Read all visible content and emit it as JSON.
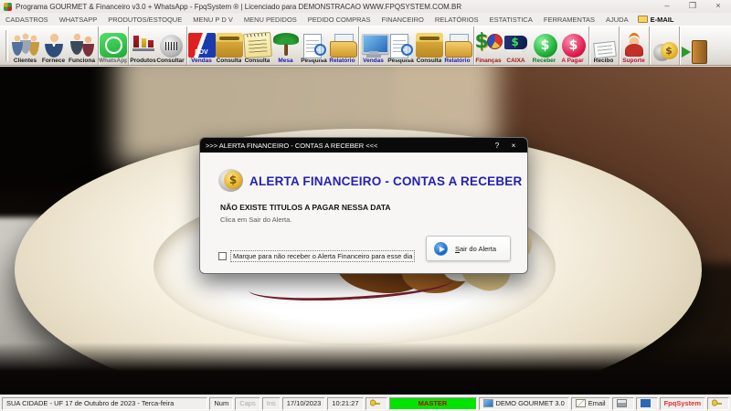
{
  "window": {
    "title": "Programa GOURMET & Financeiro v3.0 + WhatsApp - FpqSystem ® | Licenciado para  DEMONSTRACAO WWW.FPQSYSTEM.COM.BR",
    "minimize_glyph": "–",
    "maximize_glyph": "❒",
    "close_glyph": "×"
  },
  "menu": {
    "items": [
      {
        "name": "menu-cadastros",
        "label": "CADASTROS"
      },
      {
        "name": "menu-whatsapp",
        "label": "WHATSAPP"
      },
      {
        "name": "menu-produtos-estoque",
        "label": "PRODUTOS/ESTOQUE"
      },
      {
        "name": "menu-pdv",
        "label": "MENU P D V"
      },
      {
        "name": "menu-pedidos",
        "label": "MENU PEDIDOS"
      },
      {
        "name": "menu-pedido-compras",
        "label": "PEDIDO COMPRAS"
      },
      {
        "name": "menu-financeiro",
        "label": "FINANCEIRO"
      },
      {
        "name": "menu-relatorios",
        "label": "RELATÓRIOS"
      },
      {
        "name": "menu-estatistica",
        "label": "ESTATISTICA"
      },
      {
        "name": "menu-ferramentas",
        "label": "FERRAMENTAS"
      },
      {
        "name": "menu-ajuda",
        "label": "AJUDA"
      }
    ],
    "email_label": "E-MAIL"
  },
  "toolbar": {
    "items": [
      {
        "name": "toolbar-clientes",
        "icon": "clients-people-icon",
        "iclass": "i-clients",
        "label": "Clientes"
      },
      {
        "name": "toolbar-fornecedor",
        "icon": "supplier-person-icon",
        "iclass": "i-supplier",
        "label": "Fornece"
      },
      {
        "name": "toolbar-funcionario",
        "icon": "employees-people-icon",
        "iclass": "i-employees",
        "label": "Funciona"
      },
      {
        "name": "toolbar-whatsapp",
        "icon": "whatsapp-icon",
        "iclass": "i-whatsapp",
        "label": "WhatsApp",
        "color": "#666666",
        "classes": "grp"
      },
      {
        "name": "toolbar-produtos",
        "icon": "bottles-icon",
        "iclass": "i-products",
        "label": "Produtos",
        "classes": "grp"
      },
      {
        "name": "toolbar-consultar-produtos",
        "icon": "barcode-coin-icon",
        "iclass": "i-barcode",
        "label": "Consultar"
      },
      {
        "name": "toolbar-vendas-pdv",
        "icon": "pdv-flag-icon",
        "iclass": "i-pdv",
        "label": "Vendas",
        "color": "#1a1ab0",
        "classes": "grp"
      },
      {
        "name": "toolbar-consulta-pdv",
        "icon": "drawer-icon",
        "iclass": "i-drawer",
        "label": "Consulta"
      },
      {
        "name": "toolbar-consulta-cupom",
        "icon": "notepad-icon",
        "iclass": "i-notepad",
        "label": "Consulta"
      },
      {
        "name": "toolbar-mesa",
        "icon": "palm-tree-icon",
        "iclass": "i-palm",
        "label": "Mesa",
        "color": "#1a1ab0"
      },
      {
        "name": "toolbar-pesquisa-mesa",
        "icon": "search-docs-icon",
        "iclass": "i-searchdocs",
        "label": "Pesquisa"
      },
      {
        "name": "toolbar-relatorio-mesa",
        "icon": "report-folder-icon",
        "iclass": "i-folder",
        "label": "Relatório",
        "color": "#1a1ab0"
      },
      {
        "name": "toolbar-vendas",
        "icon": "monitor-sales-icon",
        "iclass": "i-monitor",
        "label": "Vendas",
        "color": "#1a1ab0",
        "classes": "grp"
      },
      {
        "name": "toolbar-pesquisa-vendas",
        "icon": "search-docs-icon",
        "iclass": "i-searchdocs",
        "label": "Pesquisa"
      },
      {
        "name": "toolbar-consulta-vendas",
        "icon": "drawer-icon",
        "iclass": "i-drawer",
        "label": "Consulta"
      },
      {
        "name": "toolbar-relatorio-vendas",
        "icon": "report-folder-icon",
        "iclass": "i-folder",
        "label": "Relatório",
        "color": "#1a1ab0"
      },
      {
        "name": "toolbar-financas",
        "icon": "money-pie-icon",
        "iclass": "i-financas",
        "label": "Finanças",
        "color": "#a01818",
        "classes": "grp"
      },
      {
        "name": "toolbar-caixa",
        "icon": "cashbook-icon",
        "iclass": "i-caixa",
        "label": "CAIXA",
        "color": "#a01818"
      },
      {
        "name": "toolbar-receber",
        "icon": "green-dollar-coin-icon",
        "iclass": "i-coin-green",
        "label": "Receber",
        "color": "#0d7a1f"
      },
      {
        "name": "toolbar-a-pagar",
        "icon": "pink-dollar-coin-icon",
        "iclass": "i-coin-pink",
        "label": "A Pagar",
        "color": "#c01030"
      },
      {
        "name": "toolbar-recibo",
        "icon": "receipt-icon",
        "iclass": "i-recibo",
        "label": "Recibo",
        "classes": "grp"
      },
      {
        "name": "toolbar-suporte",
        "icon": "support-headset-icon",
        "iclass": "i-suporte",
        "label": "Suporte",
        "color": "#c01030",
        "classes": "grp"
      },
      {
        "name": "toolbar-moedas",
        "icon": "gold-coin-icon",
        "iclass": "i-coin-gold",
        "label": "",
        "classes": "grp"
      },
      {
        "name": "toolbar-sair",
        "icon": "exit-door-icon",
        "iclass": "i-exit",
        "label": "",
        "classes": "grp"
      }
    ]
  },
  "dialog": {
    "title": ">>> ALERTA FINANCEIRO - CONTAS A RECEBER <<<",
    "help_glyph": "?",
    "close_glyph": "×",
    "heading": "ALERTA FINANCEIRO - CONTAS A RECEBER",
    "message": "NÃO EXISTE TITULOS A PAGAR NESSA DATA",
    "sub_message": "Clica em Sair do Alerta.",
    "checkbox_label": "Marque para não receber o Alerta Financeiro para esse dia",
    "checkbox_checked": false,
    "button_label": "Sair do Alerta"
  },
  "statusbar": {
    "panels": [
      {
        "name": "status-location-date",
        "text": "SUA CIDADE - UF 17 de Outubro de 2023 - Terca-feira",
        "classes": "grow"
      },
      {
        "name": "status-num-lock",
        "text": "Num"
      },
      {
        "name": "status-caps-lock",
        "text": "Caps",
        "classes": "dim"
      },
      {
        "name": "status-insert",
        "text": "Ins",
        "classes": "dim"
      },
      {
        "name": "status-date",
        "text": "17/10/2023"
      },
      {
        "name": "status-time",
        "text": "10:21:27"
      },
      {
        "name": "status-user-key",
        "text": "",
        "icon": "key-icon"
      },
      {
        "name": "status-master-user",
        "text": "MASTER",
        "classes": "master"
      },
      {
        "name": "status-app-version",
        "text": "DEMO GOURMET 3.0",
        "icon": "monitor-icon"
      },
      {
        "name": "status-email",
        "text": "Email",
        "icon": "mail-icon"
      },
      {
        "name": "status-printer",
        "text": "",
        "icon": "printer-icon"
      },
      {
        "name": "status-network",
        "text": "",
        "icon": "network-icon"
      },
      {
        "name": "status-brand",
        "text": "FpqSystem",
        "classes": "brand"
      },
      {
        "name": "status-key-2",
        "text": "",
        "icon": "key-icon"
      }
    ]
  },
  "colors": {
    "dialog_heading_blue": "#2322b2",
    "master_green": "#00e400",
    "master_text_red": "#c00000",
    "brand_red": "#e03030",
    "dialog_titlebar_black": "#0a0a0a",
    "whatsapp_green": "#1daa35"
  }
}
